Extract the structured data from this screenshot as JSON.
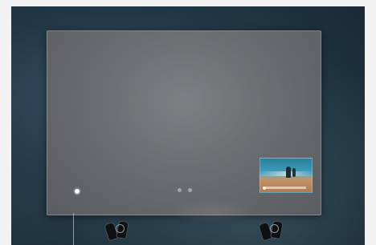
{
  "scene": {
    "pager": {
      "pages": 2
    }
  }
}
